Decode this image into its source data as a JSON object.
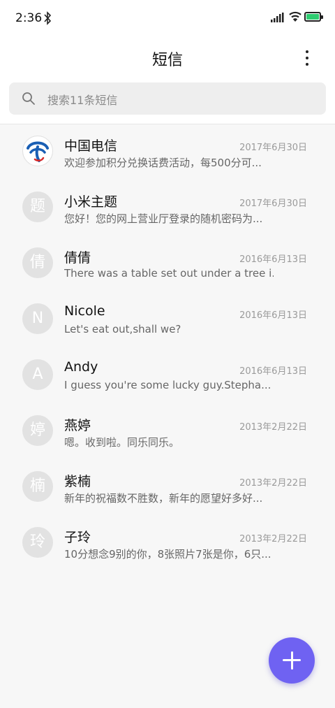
{
  "status_bar": {
    "time": "2:36",
    "icons": [
      "bluetooth-icon",
      "signal-icon",
      "wifi-icon",
      "battery-icon"
    ],
    "battery_color": "#2ecc71"
  },
  "header": {
    "title": "短信",
    "menu_icon": "more-vertical-icon"
  },
  "search": {
    "placeholder": "搜索11条短信",
    "icon": "search-icon"
  },
  "conversations": [
    {
      "avatar": "",
      "avatar_type": "china-telecom-logo",
      "name": "中国电信",
      "date": "2017年6月30日",
      "preview": "欢迎参加积分兑换话费活动，每500分可..."
    },
    {
      "avatar": "题",
      "name": "小米主题",
      "date": "2017年6月30日",
      "preview": "您好！您的网上营业厅登录的随机密码为..."
    },
    {
      "avatar": "倩",
      "name": "倩倩",
      "date": "2016年6月13日",
      "preview": "There was a table set out under a tree i..."
    },
    {
      "avatar": "N",
      "name": "Nicole",
      "date": "2016年6月13日",
      "preview": "Let's eat out,shall we?"
    },
    {
      "avatar": "A",
      "name": "Andy",
      "date": "2016年6月13日",
      "preview": "I guess you're some lucky guy.Stepha..."
    },
    {
      "avatar": "婷",
      "name": "燕婷",
      "date": "2013年2月22日",
      "preview": "嗯。收到啦。同乐同乐。"
    },
    {
      "avatar": "楠",
      "name": "紫楠",
      "date": "2013年2月22日",
      "preview": "新年的祝福数不胜数，新年的愿望好多好..."
    },
    {
      "avatar": "玲",
      "name": "子玲",
      "date": "2013年2月22日",
      "preview": "10分想念9别的你，8张照片7张是你，6只..."
    }
  ],
  "fab": {
    "icon": "plus-icon",
    "color": "#6f62f2"
  }
}
